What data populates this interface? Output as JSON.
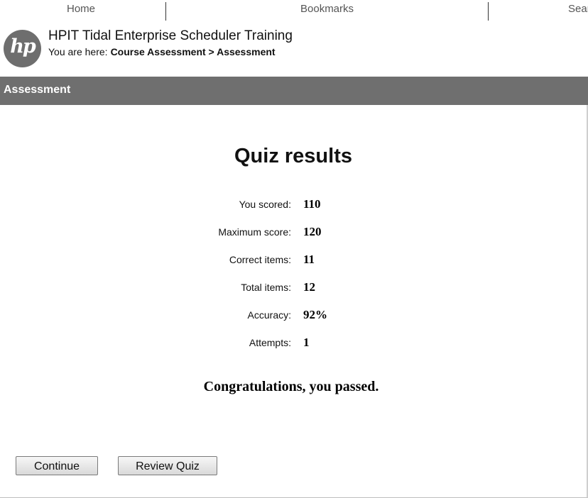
{
  "topnav": {
    "items": [
      {
        "label": "Home"
      },
      {
        "label": "Bookmarks"
      },
      {
        "label": "Sear"
      }
    ]
  },
  "header": {
    "logo_text": "hp",
    "app_title": "HPIT Tidal Enterprise Scheduler Training",
    "breadcrumb_prefix": "You are here:",
    "breadcrumb_path": "Course Assessment > Assessment"
  },
  "section": {
    "title": "Assessment"
  },
  "quiz": {
    "title": "Quiz results",
    "stats": [
      {
        "label": "You scored:",
        "value": "110"
      },
      {
        "label": "Maximum score:",
        "value": "120"
      },
      {
        "label": "Correct items:",
        "value": "11"
      },
      {
        "label": "Total items:",
        "value": "12"
      },
      {
        "label": "Accuracy:",
        "value": "92%"
      },
      {
        "label": "Attempts:",
        "value": "1"
      }
    ],
    "message": "Congratulations, you passed."
  },
  "buttons": {
    "continue_label": "Continue",
    "review_label": "Review Quiz"
  },
  "colors": {
    "section_bar": "#6f6f6f",
    "logo": "#6e6e6e"
  }
}
